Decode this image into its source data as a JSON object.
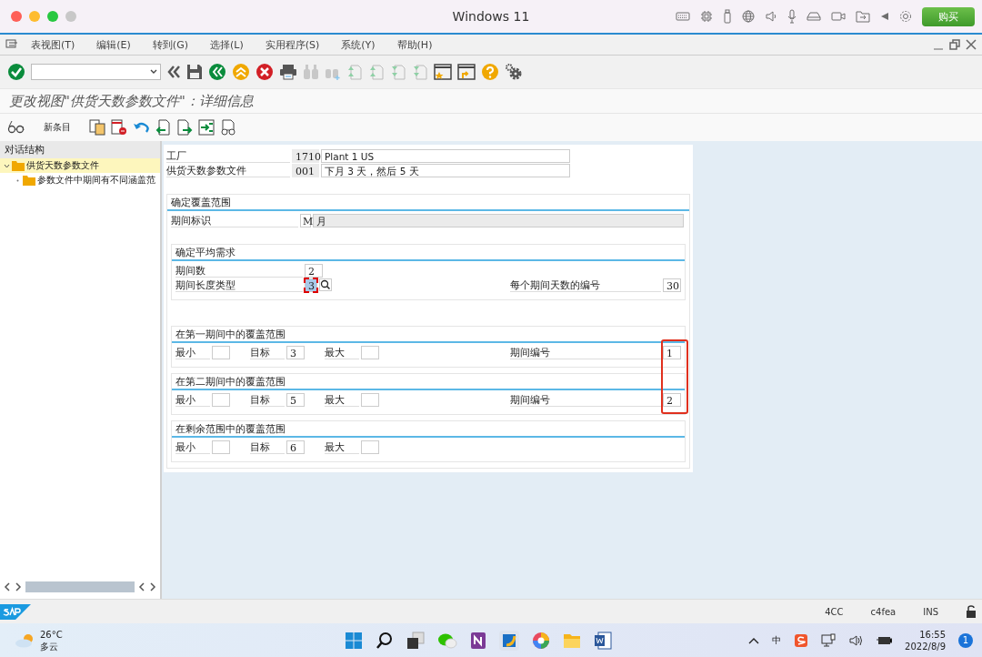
{
  "window": {
    "title": "Windows 11",
    "buy_button": "购买"
  },
  "menu": [
    "表视图(T)",
    "编辑(E)",
    "转到(G)",
    "选择(L)",
    "实用程序(S)",
    "系统(Y)",
    "帮助(H)"
  ],
  "screen_title": "更改视图\"供货天数参数文件\"：详细信息",
  "new_entry_button": "新条目",
  "tree": {
    "header": "对话结构",
    "items": [
      {
        "label": "供货天数参数文件",
        "selected": true,
        "expanded": true,
        "children": [
          {
            "label": "参数文件中期间有不同涵盖范",
            "selected": false
          }
        ]
      }
    ]
  },
  "header_fields": [
    {
      "label": "工厂",
      "code": "1710",
      "description": "Plant 1 US"
    },
    {
      "label": "供货天数参数文件",
      "code": "001",
      "description": "下月 3 天，然后 5 天"
    }
  ],
  "coverage": {
    "title": "确定覆盖范围",
    "field": {
      "label": "期间标识",
      "code": "M",
      "description": "月"
    }
  },
  "average": {
    "title": "确定平均需求",
    "periods": {
      "label": "期间数",
      "value": "2"
    },
    "length_type": {
      "label": "期间长度类型",
      "value": "3",
      "focused": true
    },
    "days": {
      "label": "每个期间天数的编号",
      "value": "30"
    }
  },
  "ranges": [
    {
      "title": "在第一期间中的覆盖范围",
      "fields": [
        {
          "label": "最小"
        },
        {
          "label": "目标",
          "value": "3"
        },
        {
          "label": "最大"
        }
      ],
      "period": {
        "label": "期间编号",
        "value": "1"
      }
    },
    {
      "title": "在第二期间中的覆盖范围",
      "fields": [
        {
          "label": "最小"
        },
        {
          "label": "目标",
          "value": "5"
        },
        {
          "label": "最大"
        }
      ],
      "period": {
        "label": "期间编号",
        "value": "2"
      }
    },
    {
      "title": "在剩余范围中的覆盖范围",
      "fields": [
        {
          "label": "最小"
        },
        {
          "label": "目标",
          "value": "6"
        },
        {
          "label": "最大"
        }
      ]
    }
  ],
  "callout_box": true,
  "status_bar": [
    "4CC",
    "c4fea",
    "INS"
  ],
  "taskbar": {
    "temperature": "26°C",
    "condition": "多云",
    "tray_ime": "中",
    "time": "16:55",
    "date": "2022/8/9",
    "notifications": "1"
  }
}
